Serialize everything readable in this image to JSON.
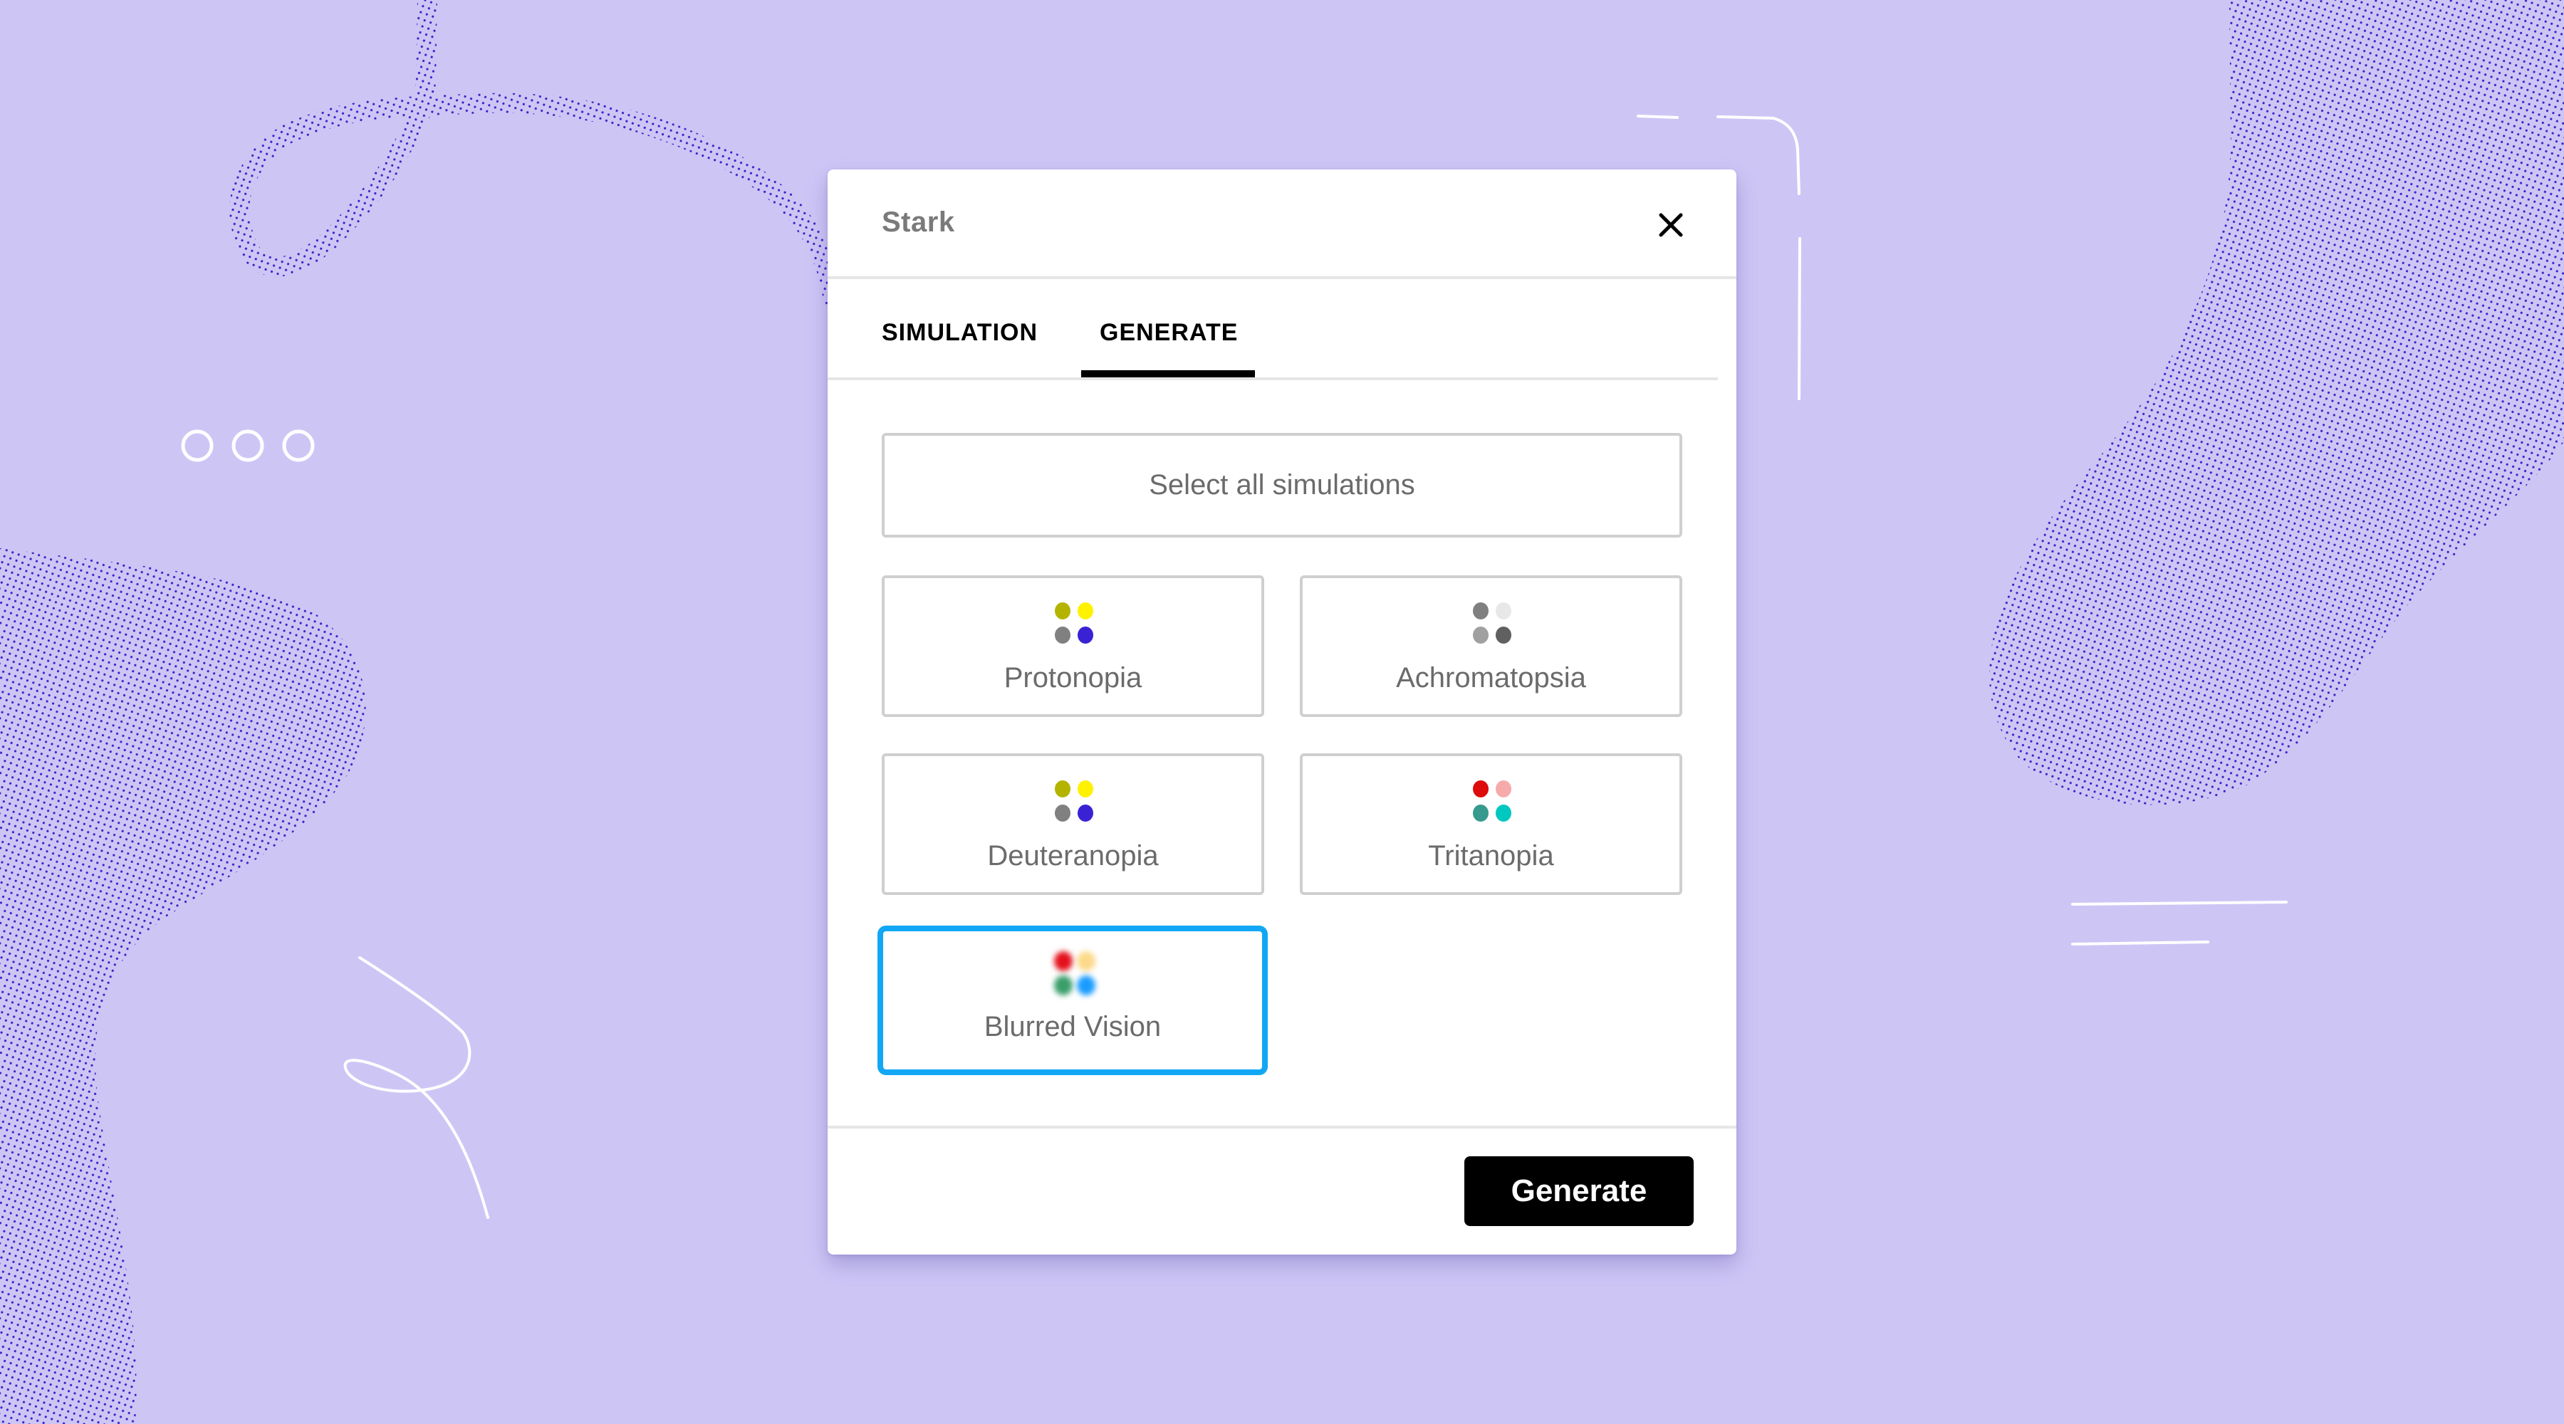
{
  "background": {
    "color": "#cdc6f5",
    "pattern_color": "#3d22c9",
    "stroke_color": "#ffffff",
    "decorations": [
      "dotted-loop",
      "dotted-blob-left",
      "dotted-blob-right",
      "three-circles",
      "white-squiggle",
      "white-bracket",
      "white-lines"
    ]
  },
  "modal": {
    "title": "Stark",
    "close_icon": "close-icon",
    "tabs": [
      {
        "label": "SIMULATION",
        "active": false
      },
      {
        "label": "GENERATE",
        "active": true
      }
    ],
    "select_all_label": "Select all simulations",
    "options": [
      {
        "label": "Protonopia",
        "selected": false,
        "dot_colors": [
          "#b4b400",
          "#fff200",
          "#808080",
          "#3a22d4"
        ]
      },
      {
        "label": "Achromatopsia",
        "selected": false,
        "dot_colors": [
          "#808080",
          "#e8e8e8",
          "#a0a0a0",
          "#606060"
        ]
      },
      {
        "label": "Deuteranopia",
        "selected": false,
        "dot_colors": [
          "#b4b400",
          "#fff200",
          "#808080",
          "#3a22d4"
        ]
      },
      {
        "label": "Tritanopia",
        "selected": false,
        "dot_colors": [
          "#dd0b0b",
          "#f7aaaa",
          "#379a8e",
          "#00c8c0"
        ]
      },
      {
        "label": "Blurred Vision",
        "selected": true,
        "dot_colors": [
          "#e4101c",
          "#fcd98a",
          "#3a9e6a",
          "#1a9cff"
        ]
      }
    ],
    "selected_color": "#12a7f5",
    "generate_label": "Generate"
  }
}
